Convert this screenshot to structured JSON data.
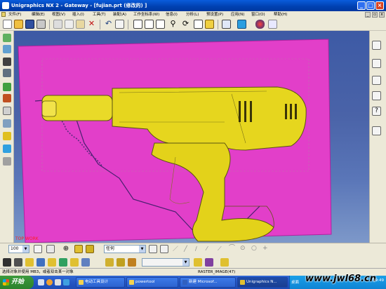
{
  "window": {
    "title": "Unigraphics NX 2 - Gateway - [fujian.prt  (修改的) ]"
  },
  "menubar": {
    "items": [
      "文件(F)",
      "编辑(E)",
      "视图(V)",
      "插入(I)",
      "工具(T)",
      "装配(A)",
      "工作坐标系(W)",
      "信息(I)",
      "分析(L)",
      "预设置(P)",
      "应用(N)",
      "窗口(O)",
      "帮助(H)"
    ]
  },
  "bottom_toolbar": {
    "zoom_value": "100",
    "filter_value": "任何"
  },
  "statusbar": {
    "prompt": "选择对象并使用 MB3，或者双击某一对象",
    "image_label": "RASTER_IMAGE(47)"
  },
  "viewport": {
    "view_label": "TOP WORK",
    "background_color": "#4a63a8",
    "raster_color": "#e23fc9",
    "model_color": "#e6d61e"
  },
  "taskbar": {
    "start_label": "开始",
    "tasks": [
      "电动工具设计",
      "powertool",
      "新建 Microsof...",
      "Unigraphics N..."
    ],
    "tray_watermark": "www.jwl68.cn",
    "tray_prefix": "桌面",
    "clock": "19:49"
  }
}
